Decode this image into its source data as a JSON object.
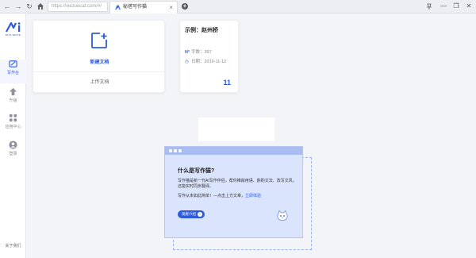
{
  "browser": {
    "url": "https://xiezuocat.com/#/",
    "tab_title": "秘塔写作猫",
    "tab_close": "×",
    "new_tab": "+"
  },
  "sidebar": {
    "logo_text": "MITA WRITE",
    "items": [
      {
        "label": "写作台",
        "icon": "desk-icon",
        "active": true
      },
      {
        "label": "升级",
        "icon": "upgrade-arrow-icon",
        "active": false
      },
      {
        "label": "应用中心",
        "icon": "apps-grid-icon",
        "active": false
      },
      {
        "label": "登录",
        "icon": "user-icon",
        "active": false
      }
    ],
    "about": "关于我们"
  },
  "new_doc_card": {
    "label": "新建文档",
    "upload": "上传文档"
  },
  "example_card": {
    "title": "示例：赵州桥",
    "word_count_label": "字数：397",
    "date_label": "日期：2019-11-12",
    "count": "11"
  },
  "dialog": {
    "title": "什么是写作猫?",
    "line1": "写作猫是新一代AI写作伴侣，帮你推敲用语、斟酌文法、改写文风，",
    "line2": "还能实时同步翻译。",
    "line3_text": "写作从未如此简单！—点击上方文章，",
    "line3_link": "立即体验",
    "button": "观看介绍"
  },
  "colors": {
    "accent": "#2e5bd9",
    "dialog_bg": "#dbe4fd",
    "dialog_header": "#a9bdf2"
  }
}
